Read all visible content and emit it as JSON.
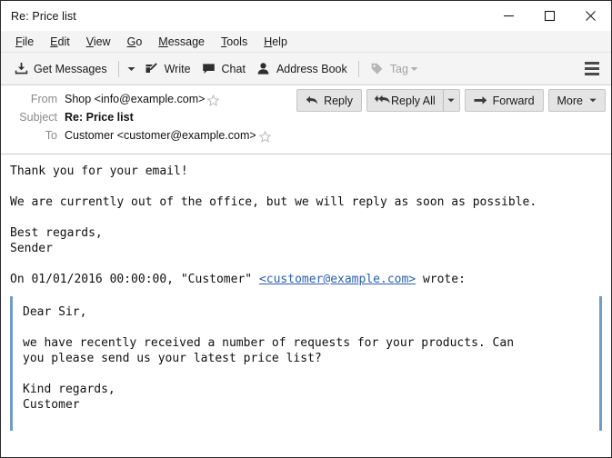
{
  "window": {
    "title": "Re: Price list",
    "controls": {
      "minimize": "minimize-button",
      "maximize": "maximize-button",
      "close": "close-button"
    }
  },
  "menubar": {
    "items": [
      {
        "label": "File",
        "accesskey": "F"
      },
      {
        "label": "Edit",
        "accesskey": "E"
      },
      {
        "label": "View",
        "accesskey": "V"
      },
      {
        "label": "Go",
        "accesskey": "G"
      },
      {
        "label": "Message",
        "accesskey": "M"
      },
      {
        "label": "Tools",
        "accesskey": "T"
      },
      {
        "label": "Help",
        "accesskey": "H"
      }
    ]
  },
  "toolbar": {
    "get_messages": {
      "label": "Get Messages",
      "icon": "download-icon",
      "has_dropdown": true
    },
    "write": {
      "label": "Write",
      "icon": "pencil-compose-icon"
    },
    "chat": {
      "label": "Chat",
      "icon": "speech-bubble-icon"
    },
    "address_book": {
      "label": "Address Book",
      "icon": "person-icon"
    },
    "tag": {
      "label": "Tag",
      "icon": "tag-icon",
      "has_dropdown": true,
      "disabled": true
    },
    "app_menu": {
      "icon": "hamburger-menu-icon"
    }
  },
  "header": {
    "rows": [
      {
        "label": "From",
        "value": "Shop <info@example.com>",
        "bold": false,
        "star": true
      },
      {
        "label": "Subject",
        "value": "Re: Price list",
        "bold": true,
        "star": false
      },
      {
        "label": "To",
        "value": "Customer <customer@example.com>",
        "bold": false,
        "star": true
      }
    ],
    "actions": {
      "reply": "Reply",
      "reply_all": "Reply All",
      "forward": "Forward",
      "more": "More"
    }
  },
  "message": {
    "lines_before_quote": [
      "Thank you for your email!",
      "",
      "We are currently out of the office, but we will reply as soon as possible.",
      "",
      "Best regards,",
      "Sender",
      ""
    ],
    "attribution": {
      "prefix": "On 01/01/2016 00:00:00, \"Customer\" ",
      "link": "<customer@example.com>",
      "suffix": " wrote:"
    },
    "quote_lines": [
      "Dear Sir,",
      "",
      "we have recently received a number of requests for your products. Can",
      "you please send us your latest price list?",
      "",
      "Kind regards,",
      "Customer"
    ]
  },
  "colors": {
    "link": "#2b5fb0",
    "quote_bar": "#6f9bd1",
    "toolbar_bg": "#f4f4f4",
    "header_label": "#8a8a8a"
  }
}
